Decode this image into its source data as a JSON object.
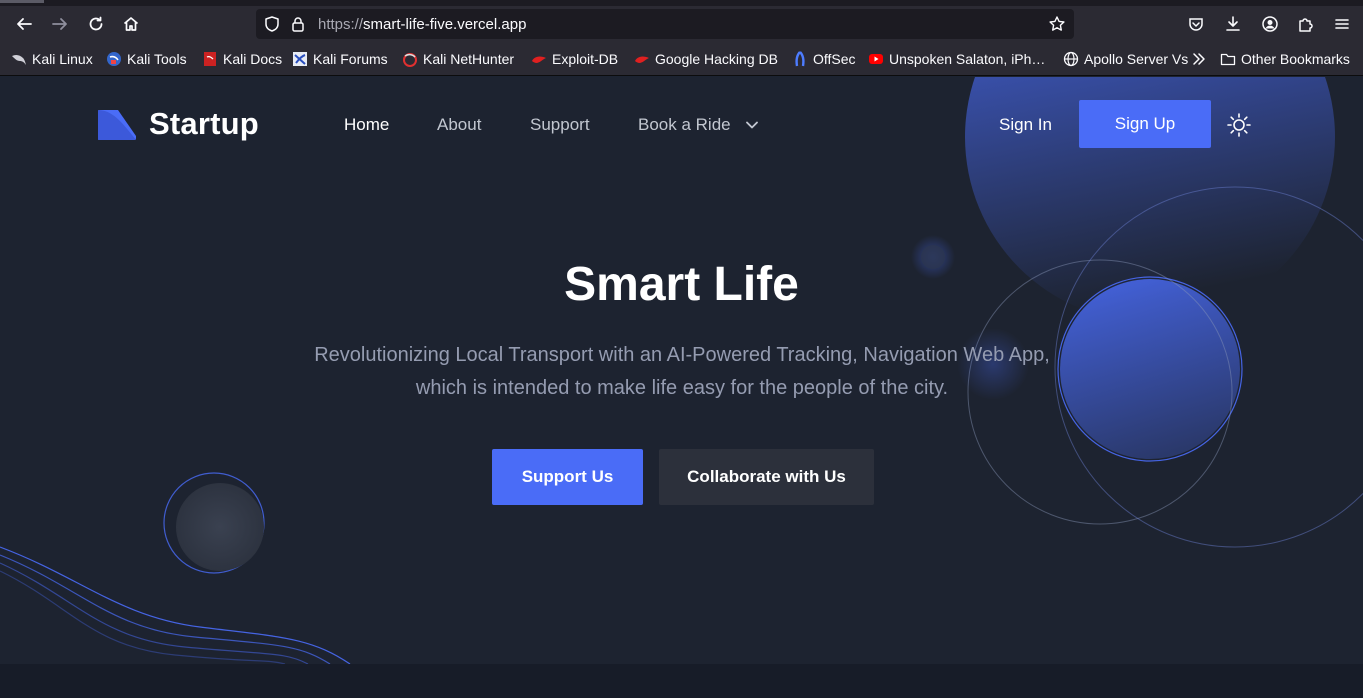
{
  "browser": {
    "url_protocol": "https://",
    "url_host": "smart-life-five.vercel.app",
    "bookmarks": [
      {
        "label": "Kali Linux",
        "icon": "kali-dragon-icon"
      },
      {
        "label": "Kali Tools",
        "icon": "kali-tools-icon"
      },
      {
        "label": "Kali Docs",
        "icon": "kali-docs-icon"
      },
      {
        "label": "Kali Forums",
        "icon": "kali-forums-icon"
      },
      {
        "label": "Kali NetHunter",
        "icon": "nethunter-icon"
      },
      {
        "label": "Exploit-DB",
        "icon": "exploit-db-icon"
      },
      {
        "label": "Google Hacking DB",
        "icon": "ghdb-icon"
      },
      {
        "label": "OffSec",
        "icon": "offsec-icon"
      },
      {
        "label": "Unspoken Salaton, iPh…",
        "icon": "youtube-icon"
      },
      {
        "label": "Apollo Server Vs",
        "icon": "globe-icon"
      }
    ],
    "other_bookmarks": "Other Bookmarks"
  },
  "site": {
    "logo_text": "Startup",
    "nav": {
      "home": "Home",
      "about": "About",
      "support": "Support",
      "book": "Book a Ride"
    },
    "sign_in": "Sign In",
    "sign_up": "Sign Up"
  },
  "hero": {
    "title": "Smart Life",
    "subtitle_line1": "Revolutionizing Local Transport with an AI-Powered Tracking, Navigation Web App,",
    "subtitle_line2": "which is intended to make life easy for the people of the city.",
    "primary_cta": "Support Us",
    "secondary_cta": "Collaborate with Us"
  },
  "colors": {
    "accent": "#4a6cf7",
    "page_bg": "#1d2330",
    "secondary_button": "#2c303b",
    "subtitle_text": "#959cb1"
  }
}
